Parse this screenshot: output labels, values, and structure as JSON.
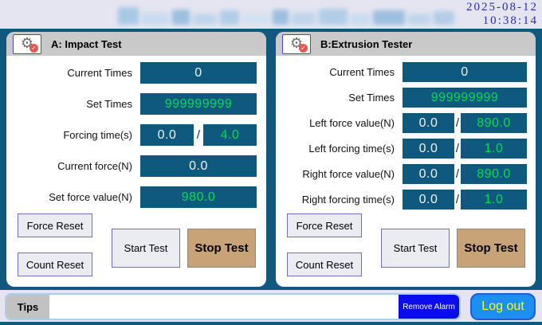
{
  "titlebar": {
    "date": "2025-08-12",
    "time": "10:38:14"
  },
  "icons": {
    "gear": "⚙",
    "check": "✓",
    "slash": "/"
  },
  "panel_a": {
    "title": "A: Impact Test",
    "rows": [
      {
        "label": "Current Times",
        "value": "0"
      },
      {
        "label": "Set Times",
        "value": "999999999"
      },
      {
        "label": "Forcing time(s)",
        "value": "0.0",
        "slash": "/",
        "set": "4.0"
      },
      {
        "label": "Current force(N)",
        "value": "0.0"
      },
      {
        "label": "Set force value(N)",
        "value": "980.0"
      }
    ],
    "buttons": {
      "force_reset": "Force Reset",
      "count_reset": "Count Reset",
      "start": "Start Test",
      "stop": "Stop Test"
    }
  },
  "panel_b": {
    "title": "B:Extrusion Tester",
    "rows": [
      {
        "label": "Current Times",
        "value": "0"
      },
      {
        "label": "Set Times",
        "value": "999999999"
      },
      {
        "label": "Left force value(N)",
        "value": "0.0",
        "slash": "/",
        "set": "890.0"
      },
      {
        "label": "Left forcing time(s)",
        "value": "0.0",
        "slash": "/",
        "set": "1.0"
      },
      {
        "label": "Right force value(N)",
        "value": "0.0",
        "slash": "/",
        "set": "890.0"
      },
      {
        "label": "Right forcing time(s)",
        "value": "0.0",
        "slash": "/",
        "set": "1.0"
      }
    ],
    "buttons": {
      "force_reset": "Force Reset",
      "count_reset": "Count Reset",
      "start": "Start Test",
      "stop": "Stop Test"
    }
  },
  "bottombar": {
    "tips_label": "Tips",
    "message": "",
    "remove_alarm": "Remove Alarm",
    "logout": "Log out"
  },
  "colors": {
    "teal_bg": "#11587e",
    "value_box_bg": "#0f587e",
    "value_green": "#00dc50",
    "stop_button_tan": "#c8a377",
    "alarm_blue": "#0b0bf0",
    "logout_blue": "#1d8ff2",
    "logout_text_yellow": "#ffff00",
    "datetime_navy": "#2a2ab2"
  }
}
